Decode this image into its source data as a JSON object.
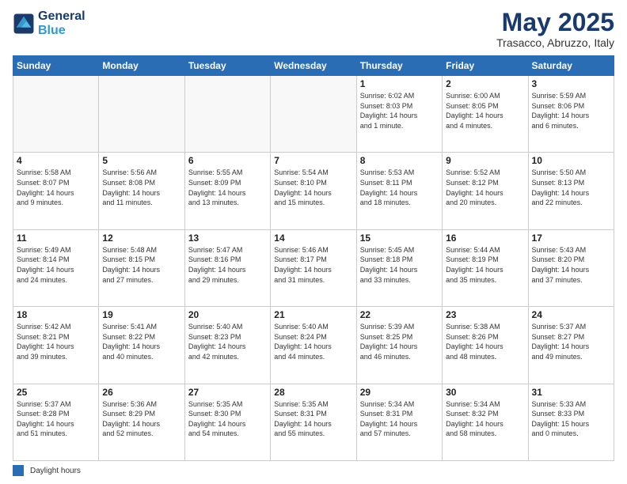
{
  "header": {
    "logo_line1": "General",
    "logo_line2": "Blue",
    "month": "May 2025",
    "location": "Trasacco, Abruzzo, Italy"
  },
  "weekdays": [
    "Sunday",
    "Monday",
    "Tuesday",
    "Wednesday",
    "Thursday",
    "Friday",
    "Saturday"
  ],
  "legend_label": "Daylight hours",
  "weeks": [
    [
      {
        "day": "",
        "info": ""
      },
      {
        "day": "",
        "info": ""
      },
      {
        "day": "",
        "info": ""
      },
      {
        "day": "",
        "info": ""
      },
      {
        "day": "1",
        "info": "Sunrise: 6:02 AM\nSunset: 8:03 PM\nDaylight: 14 hours\nand 1 minute."
      },
      {
        "day": "2",
        "info": "Sunrise: 6:00 AM\nSunset: 8:05 PM\nDaylight: 14 hours\nand 4 minutes."
      },
      {
        "day": "3",
        "info": "Sunrise: 5:59 AM\nSunset: 8:06 PM\nDaylight: 14 hours\nand 6 minutes."
      }
    ],
    [
      {
        "day": "4",
        "info": "Sunrise: 5:58 AM\nSunset: 8:07 PM\nDaylight: 14 hours\nand 9 minutes."
      },
      {
        "day": "5",
        "info": "Sunrise: 5:56 AM\nSunset: 8:08 PM\nDaylight: 14 hours\nand 11 minutes."
      },
      {
        "day": "6",
        "info": "Sunrise: 5:55 AM\nSunset: 8:09 PM\nDaylight: 14 hours\nand 13 minutes."
      },
      {
        "day": "7",
        "info": "Sunrise: 5:54 AM\nSunset: 8:10 PM\nDaylight: 14 hours\nand 15 minutes."
      },
      {
        "day": "8",
        "info": "Sunrise: 5:53 AM\nSunset: 8:11 PM\nDaylight: 14 hours\nand 18 minutes."
      },
      {
        "day": "9",
        "info": "Sunrise: 5:52 AM\nSunset: 8:12 PM\nDaylight: 14 hours\nand 20 minutes."
      },
      {
        "day": "10",
        "info": "Sunrise: 5:50 AM\nSunset: 8:13 PM\nDaylight: 14 hours\nand 22 minutes."
      }
    ],
    [
      {
        "day": "11",
        "info": "Sunrise: 5:49 AM\nSunset: 8:14 PM\nDaylight: 14 hours\nand 24 minutes."
      },
      {
        "day": "12",
        "info": "Sunrise: 5:48 AM\nSunset: 8:15 PM\nDaylight: 14 hours\nand 27 minutes."
      },
      {
        "day": "13",
        "info": "Sunrise: 5:47 AM\nSunset: 8:16 PM\nDaylight: 14 hours\nand 29 minutes."
      },
      {
        "day": "14",
        "info": "Sunrise: 5:46 AM\nSunset: 8:17 PM\nDaylight: 14 hours\nand 31 minutes."
      },
      {
        "day": "15",
        "info": "Sunrise: 5:45 AM\nSunset: 8:18 PM\nDaylight: 14 hours\nand 33 minutes."
      },
      {
        "day": "16",
        "info": "Sunrise: 5:44 AM\nSunset: 8:19 PM\nDaylight: 14 hours\nand 35 minutes."
      },
      {
        "day": "17",
        "info": "Sunrise: 5:43 AM\nSunset: 8:20 PM\nDaylight: 14 hours\nand 37 minutes."
      }
    ],
    [
      {
        "day": "18",
        "info": "Sunrise: 5:42 AM\nSunset: 8:21 PM\nDaylight: 14 hours\nand 39 minutes."
      },
      {
        "day": "19",
        "info": "Sunrise: 5:41 AM\nSunset: 8:22 PM\nDaylight: 14 hours\nand 40 minutes."
      },
      {
        "day": "20",
        "info": "Sunrise: 5:40 AM\nSunset: 8:23 PM\nDaylight: 14 hours\nand 42 minutes."
      },
      {
        "day": "21",
        "info": "Sunrise: 5:40 AM\nSunset: 8:24 PM\nDaylight: 14 hours\nand 44 minutes."
      },
      {
        "day": "22",
        "info": "Sunrise: 5:39 AM\nSunset: 8:25 PM\nDaylight: 14 hours\nand 46 minutes."
      },
      {
        "day": "23",
        "info": "Sunrise: 5:38 AM\nSunset: 8:26 PM\nDaylight: 14 hours\nand 48 minutes."
      },
      {
        "day": "24",
        "info": "Sunrise: 5:37 AM\nSunset: 8:27 PM\nDaylight: 14 hours\nand 49 minutes."
      }
    ],
    [
      {
        "day": "25",
        "info": "Sunrise: 5:37 AM\nSunset: 8:28 PM\nDaylight: 14 hours\nand 51 minutes."
      },
      {
        "day": "26",
        "info": "Sunrise: 5:36 AM\nSunset: 8:29 PM\nDaylight: 14 hours\nand 52 minutes."
      },
      {
        "day": "27",
        "info": "Sunrise: 5:35 AM\nSunset: 8:30 PM\nDaylight: 14 hours\nand 54 minutes."
      },
      {
        "day": "28",
        "info": "Sunrise: 5:35 AM\nSunset: 8:31 PM\nDaylight: 14 hours\nand 55 minutes."
      },
      {
        "day": "29",
        "info": "Sunrise: 5:34 AM\nSunset: 8:31 PM\nDaylight: 14 hours\nand 57 minutes."
      },
      {
        "day": "30",
        "info": "Sunrise: 5:34 AM\nSunset: 8:32 PM\nDaylight: 14 hours\nand 58 minutes."
      },
      {
        "day": "31",
        "info": "Sunrise: 5:33 AM\nSunset: 8:33 PM\nDaylight: 15 hours\nand 0 minutes."
      }
    ]
  ]
}
